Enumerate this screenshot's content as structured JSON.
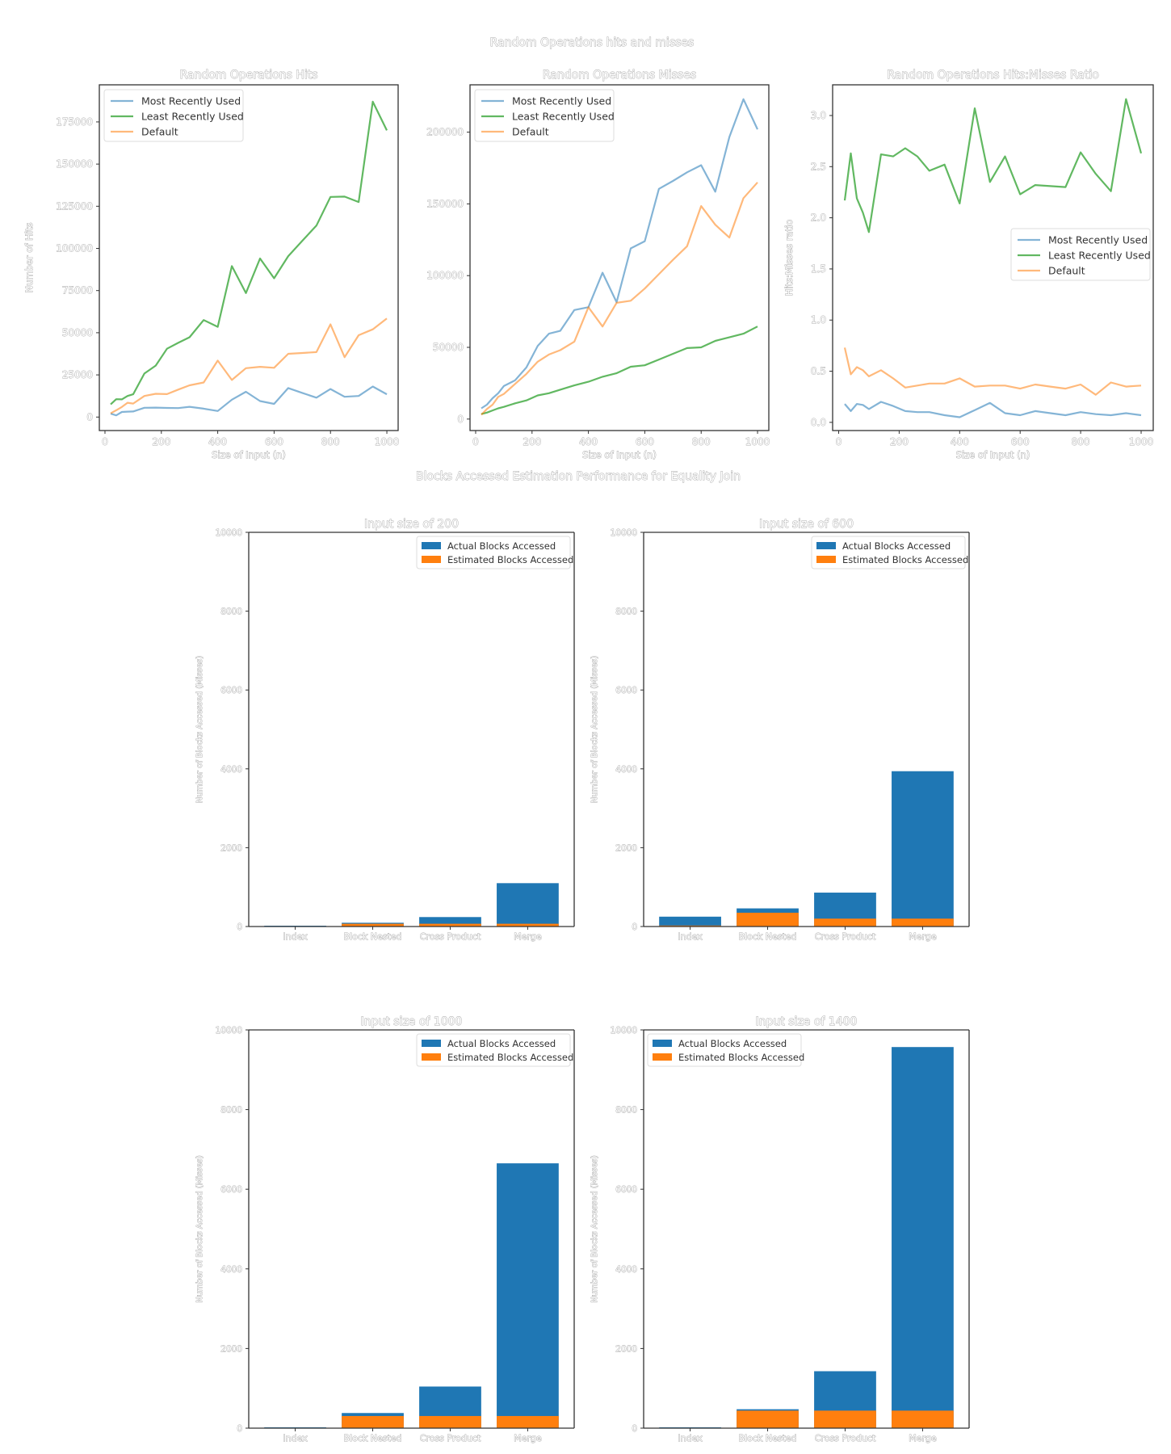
{
  "figure1": {
    "suptitle": "Random Operations hits and misses",
    "legend": [
      "Most Recently Used",
      "Least Recently Used",
      "Default"
    ],
    "colors": {
      "mru": "#1f77b4",
      "lru": "#2ca02c",
      "default": "#ff7f0e"
    }
  },
  "figure2": {
    "suptitle": "Blocks Accessed Estimation Performance for Equality Join",
    "legend": [
      "Actual Blocks Accessed",
      "Estimated Blocks Accessed"
    ],
    "colors": {
      "actual": "#1f77b4",
      "estimated": "#ff7f0e"
    }
  },
  "chart_data": [
    {
      "type": "line",
      "title": "Random Operations Hits",
      "xlabel": "Size of Input (n)",
      "ylabel": "Number of Hits",
      "xlim": [
        -20,
        1040
      ],
      "ylim": [
        -8000,
        197000
      ],
      "xticks": [
        0,
        200,
        400,
        600,
        800,
        1000
      ],
      "yticks": [
        0,
        25000,
        50000,
        75000,
        100000,
        125000,
        150000,
        175000
      ],
      "legend_position": "top-left",
      "x": [
        20,
        40,
        60,
        80,
        100,
        140,
        180,
        220,
        260,
        300,
        350,
        400,
        450,
        500,
        550,
        600,
        650,
        700,
        750,
        800,
        850,
        900,
        950,
        1000
      ],
      "series": [
        {
          "name": "Most Recently Used",
          "key": "mru",
          "values": [
            2000,
            1000,
            3000,
            3200,
            3300,
            5500,
            5600,
            5400,
            5300,
            6100,
            5000,
            3600,
            10300,
            15000,
            9500,
            7800,
            17200,
            14300,
            11500,
            16600,
            12000,
            12500,
            18100,
            13500
          ]
        },
        {
          "name": "Least Recently Used",
          "key": "lru",
          "values": [
            7500,
            10600,
            10500,
            12500,
            13500,
            25800,
            30500,
            40500,
            44000,
            47300,
            57500,
            53500,
            89500,
            73500,
            94000,
            82300,
            95400,
            104500,
            113500,
            130500,
            130700,
            127500,
            187000,
            170000
          ]
        },
        {
          "name": "Default",
          "key": "default",
          "values": [
            2200,
            4000,
            6000,
            8500,
            8000,
            12500,
            13800,
            13600,
            16300,
            18800,
            20500,
            33500,
            22000,
            29000,
            29800,
            29200,
            37500,
            38000,
            38500,
            55000,
            35500,
            48500,
            52000,
            58500
          ]
        }
      ]
    },
    {
      "type": "line",
      "title": "Random Operations Misses",
      "xlabel": "Size of Input (n)",
      "ylabel": "",
      "xlim": [
        -20,
        1040
      ],
      "ylim": [
        -8000,
        233000
      ],
      "xticks": [
        0,
        200,
        400,
        600,
        800,
        1000
      ],
      "yticks": [
        0,
        50000,
        100000,
        150000,
        200000
      ],
      "legend_position": "top-left",
      "x": [
        20,
        40,
        60,
        80,
        100,
        140,
        180,
        220,
        260,
        300,
        350,
        400,
        450,
        500,
        550,
        600,
        650,
        700,
        750,
        800,
        850,
        900,
        950,
        1000
      ],
      "series": [
        {
          "name": "Most Recently Used",
          "key": "mru",
          "values": [
            7500,
            10000,
            14500,
            18000,
            23000,
            27000,
            36000,
            51000,
            59500,
            61500,
            76000,
            78000,
            102000,
            81500,
            119000,
            124000,
            160500,
            166000,
            172000,
            177000,
            158500,
            196500,
            223000,
            202000
          ]
        },
        {
          "name": "Least Recently Used",
          "key": "lru",
          "values": [
            3500,
            4500,
            6000,
            7500,
            8500,
            11000,
            13000,
            16500,
            18000,
            20500,
            23500,
            26000,
            29500,
            32000,
            36500,
            37500,
            41500,
            45500,
            49500,
            50000,
            54500,
            57000,
            59500,
            64500
          ]
        },
        {
          "name": "Default",
          "key": "default",
          "values": [
            3000,
            7000,
            10000,
            15500,
            17500,
            24500,
            31500,
            40000,
            45000,
            48000,
            54000,
            78000,
            64500,
            81000,
            82500,
            91000,
            101000,
            111000,
            120500,
            148500,
            135500,
            126500,
            154000,
            165000
          ]
        }
      ]
    },
    {
      "type": "line",
      "title": "Random Operations Hits:Misses Ratio",
      "xlabel": "Size of Input (n)",
      "ylabel": "Hits:Misses ratio",
      "xlim": [
        -20,
        1040
      ],
      "ylim": [
        -0.08,
        3.3
      ],
      "xticks": [
        0,
        200,
        400,
        600,
        800,
        1000
      ],
      "yticks": [
        0.0,
        0.5,
        1.0,
        1.5,
        2.0,
        2.5,
        3.0
      ],
      "legend_position": "center-right",
      "x": [
        20,
        40,
        60,
        80,
        100,
        140,
        180,
        220,
        260,
        300,
        350,
        400,
        450,
        500,
        550,
        600,
        650,
        700,
        750,
        800,
        850,
        900,
        950,
        1000
      ],
      "series": [
        {
          "name": "Most Recently Used",
          "key": "mru",
          "values": [
            0.18,
            0.11,
            0.18,
            0.17,
            0.13,
            0.2,
            0.16,
            0.11,
            0.1,
            0.1,
            0.07,
            0.05,
            0.12,
            0.19,
            0.09,
            0.07,
            0.11,
            0.09,
            0.07,
            0.1,
            0.08,
            0.07,
            0.09,
            0.07
          ]
        },
        {
          "name": "Least Recently Used",
          "key": "lru",
          "values": [
            2.17,
            2.63,
            2.19,
            2.05,
            1.86,
            2.62,
            2.6,
            2.68,
            2.6,
            2.46,
            2.52,
            2.14,
            3.07,
            2.35,
            2.6,
            2.23,
            2.32,
            2.31,
            2.3,
            2.64,
            2.43,
            2.26,
            3.16,
            2.63
          ]
        },
        {
          "name": "Default",
          "key": "default",
          "values": [
            0.73,
            0.47,
            0.54,
            0.51,
            0.45,
            0.51,
            0.43,
            0.34,
            0.36,
            0.38,
            0.38,
            0.43,
            0.35,
            0.36,
            0.36,
            0.33,
            0.37,
            0.35,
            0.33,
            0.37,
            0.27,
            0.39,
            0.35,
            0.36
          ]
        }
      ]
    },
    {
      "type": "bar",
      "title": "Input size of 200",
      "ylabel": "Number of Blocks Accessed (Misses)",
      "categories": [
        "Index",
        "Block Nested",
        "Cross Product",
        "Merge"
      ],
      "ylim": [
        0,
        10000
      ],
      "yticks": [
        0,
        2000,
        4000,
        6000,
        8000,
        10000
      ],
      "legend_position": "top-right",
      "series": [
        {
          "name": "Actual Blocks Accessed",
          "key": "actual",
          "values": [
            20,
            95,
            240,
            1100
          ]
        },
        {
          "name": "Estimated Blocks Accessed",
          "key": "estimated",
          "values": [
            5,
            70,
            70,
            70
          ]
        }
      ]
    },
    {
      "type": "bar",
      "title": "Input size of 600",
      "ylabel": "Number of Blocks Accessed (Misses)",
      "categories": [
        "Index",
        "Block Nested",
        "Cross Product",
        "Merge"
      ],
      "ylim": [
        0,
        10000
      ],
      "yticks": [
        0,
        2000,
        4000,
        6000,
        8000,
        10000
      ],
      "legend_position": "top-right",
      "series": [
        {
          "name": "Actual Blocks Accessed",
          "key": "actual",
          "values": [
            250,
            460,
            860,
            3940
          ]
        },
        {
          "name": "Estimated Blocks Accessed",
          "key": "estimated",
          "values": [
            25,
            350,
            200,
            200
          ]
        }
      ]
    },
    {
      "type": "bar",
      "title": "Input size of 1000",
      "ylabel": "Number of Blocks Accessed (Misses)",
      "categories": [
        "Index",
        "Block Nested",
        "Cross Product",
        "Merge"
      ],
      "ylim": [
        0,
        10000
      ],
      "yticks": [
        0,
        2000,
        4000,
        6000,
        8000,
        10000
      ],
      "legend_position": "top-right",
      "series": [
        {
          "name": "Actual Blocks Accessed",
          "key": "actual",
          "values": [
            20,
            380,
            1045,
            6650
          ]
        },
        {
          "name": "Estimated Blocks Accessed",
          "key": "estimated",
          "values": [
            5,
            305,
            305,
            305
          ]
        }
      ]
    },
    {
      "type": "bar",
      "title": "Input size of 1400",
      "ylabel": "Number of Blocks Accessed (Misses)",
      "categories": [
        "Index",
        "Block Nested",
        "Cross Product",
        "Merge"
      ],
      "ylim": [
        0,
        10000
      ],
      "yticks": [
        0,
        2000,
        4000,
        6000,
        8000,
        10000
      ],
      "legend_position": "top-left",
      "series": [
        {
          "name": "Actual Blocks Accessed",
          "key": "actual",
          "values": [
            20,
            475,
            1430,
            9570
          ]
        },
        {
          "name": "Estimated Blocks Accessed",
          "key": "estimated",
          "values": [
            5,
            440,
            440,
            440
          ]
        }
      ]
    }
  ]
}
